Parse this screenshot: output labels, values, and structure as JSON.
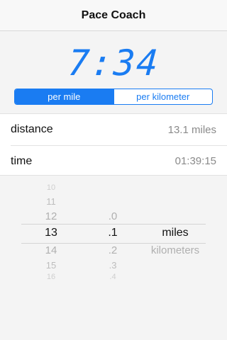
{
  "nav": {
    "title": "Pace Coach"
  },
  "pace": {
    "display": "7:34"
  },
  "segments": [
    {
      "label": "per mile",
      "active": true
    },
    {
      "label": "per kilometer",
      "active": false
    }
  ],
  "rows": [
    {
      "label": "distance",
      "value": "13.1 miles"
    },
    {
      "label": "time",
      "value": "01:39:15"
    }
  ],
  "picker": {
    "integer": {
      "items": [
        "10",
        "11",
        "12",
        "13",
        "14",
        "15",
        "16"
      ],
      "selected": "13"
    },
    "decimal": {
      "items": [
        ".0",
        ".1",
        ".2",
        ".3",
        ".4"
      ],
      "selected": ".1"
    },
    "unit": {
      "items": [
        "miles",
        "kilometers"
      ],
      "selected": "miles"
    }
  },
  "colors": {
    "accent": "#1a7cf2"
  }
}
